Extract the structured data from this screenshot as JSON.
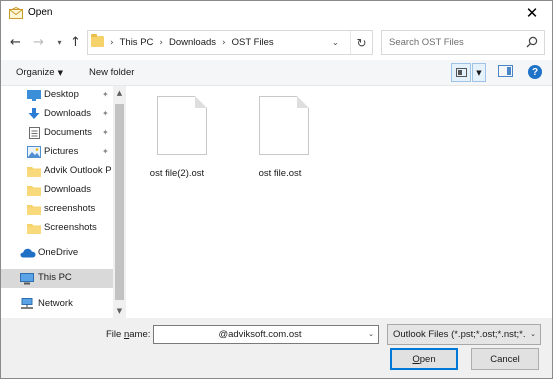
{
  "window": {
    "title": "Open"
  },
  "toolbar": {
    "breadcrumbs": [
      "This PC",
      "Downloads",
      "OST Files"
    ],
    "search_placeholder": "Search OST Files",
    "organize_label": "Organize",
    "new_folder_label": "New folder"
  },
  "sidebar": {
    "items": [
      {
        "label": "Desktop",
        "icon": "desktop-icon",
        "pinned": true
      },
      {
        "label": "Downloads",
        "icon": "download-arrow-icon",
        "pinned": true
      },
      {
        "label": "Documents",
        "icon": "documents-icon",
        "pinned": true
      },
      {
        "label": "Pictures",
        "icon": "pictures-icon",
        "pinned": true
      },
      {
        "label": "Advik Outlook P",
        "icon": "folder-icon",
        "pinned": false
      },
      {
        "label": "Downloads",
        "icon": "folder-icon",
        "pinned": false
      },
      {
        "label": "screenshots",
        "icon": "folder-icon",
        "pinned": false
      },
      {
        "label": "Screenshots",
        "icon": "folder-icon",
        "pinned": false
      },
      {
        "label": "OneDrive",
        "icon": "cloud-icon",
        "pinned": false
      },
      {
        "label": "This PC",
        "icon": "computer-icon",
        "pinned": false,
        "selected": true
      },
      {
        "label": "Network",
        "icon": "network-icon",
        "pinned": false
      }
    ]
  },
  "files": [
    {
      "name": "ost file(2).ost",
      "icon": "blank-document-icon"
    },
    {
      "name": "ost file.ost",
      "icon": "blank-document-icon"
    }
  ],
  "footer": {
    "filename_label_prefix": "File ",
    "filename_label_accel": "n",
    "filename_label_suffix": "ame:",
    "filename_value": "@adviksoft.com.ost",
    "filetype_value": "Outlook Files (*.pst;*.ost;*.nst;*.",
    "open_label_accel": "O",
    "open_label_rest": "pen",
    "cancel_label": "Cancel"
  },
  "colors": {
    "accent": "#0078d7",
    "folder": "#f6d36a",
    "selected_bg": "#d9d9d9",
    "help": "#1e72c8"
  }
}
